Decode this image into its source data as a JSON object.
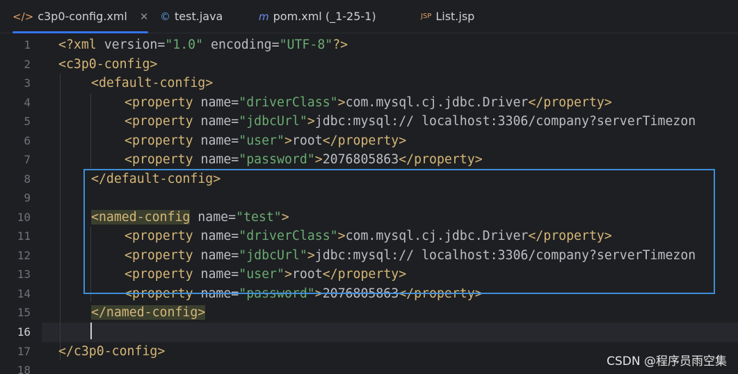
{
  "tabs": [
    {
      "label": "c3p0-config.xml",
      "icon": "xml-icon",
      "active": true,
      "closable": true
    },
    {
      "label": "test.java",
      "icon": "java-class-icon"
    },
    {
      "label": "pom.xml (_1-25-1)",
      "icon": "maven-icon"
    },
    {
      "label": "List.jsp",
      "icon": "jsp-icon"
    }
  ],
  "line_numbers": [
    "1",
    "2",
    "3",
    "4",
    "5",
    "6",
    "7",
    "8",
    "9",
    "10",
    "11",
    "12",
    "13",
    "14",
    "15",
    "16",
    "17",
    "18"
  ],
  "code": {
    "l1": {
      "a": "<?xml ",
      "b": "version",
      "c": "=",
      "d": "\"1.0\"",
      "e": " encoding",
      "f": "=",
      "g": "\"UTF-8\"",
      "h": "?>"
    },
    "l2": "<c3p0-config>",
    "l3": "<default-config>",
    "l4": {
      "open": "<property ",
      "attr": "name=",
      "val": "\"driverClass\"",
      "gt": ">",
      "text": "com.mysql.cj.jdbc.Driver",
      "close": "</property>"
    },
    "l5": {
      "open": "<property ",
      "attr": "name=",
      "val": "\"jdbcUrl\"",
      "gt": ">",
      "text": "jdbc:mysql:// localhost:3306/company?serverTimezon"
    },
    "l6": {
      "open": "<property ",
      "attr": "name=",
      "val": "\"user\"",
      "gt": ">",
      "text": "root",
      "close": "</property>"
    },
    "l7": {
      "open": "<property ",
      "attr": "name=",
      "val": "\"password\"",
      "gt": ">",
      "text": "2076805863",
      "close": "</property>"
    },
    "l8": "</default-config>",
    "l10": {
      "open": "<named-config",
      "attr": " name=",
      "val": "\"test\"",
      "gt": ">"
    },
    "l11": {
      "open": "<property ",
      "attr": "name=",
      "val": "\"driverClass\"",
      "gt": ">",
      "text": "com.mysql.cj.jdbc.Driver",
      "close": "</property>"
    },
    "l12": {
      "open": "<property ",
      "attr": "name=",
      "val": "\"jdbcUrl\"",
      "gt": ">",
      "text": "jdbc:mysql:// localhost:3306/company?serverTimezon"
    },
    "l13": {
      "open": "<property ",
      "attr": "name=",
      "val": "\"user\"",
      "gt": ">",
      "text": "root",
      "close": "</property>"
    },
    "l14": {
      "open": "<property ",
      "attr": "name=",
      "val": "\"password\"",
      "gt": ">",
      "text": "2076805863",
      "close": "</property>"
    },
    "l15": "</named-config>",
    "l17": "</c3p0-config>"
  },
  "watermark": "CSDN @程序员雨空集",
  "colors": {
    "tag": "#d5b778",
    "string": "#6aab73",
    "text": "#bcbec4",
    "highlight_box": "#3d8fdb",
    "tab_underline": "#3574f0"
  }
}
